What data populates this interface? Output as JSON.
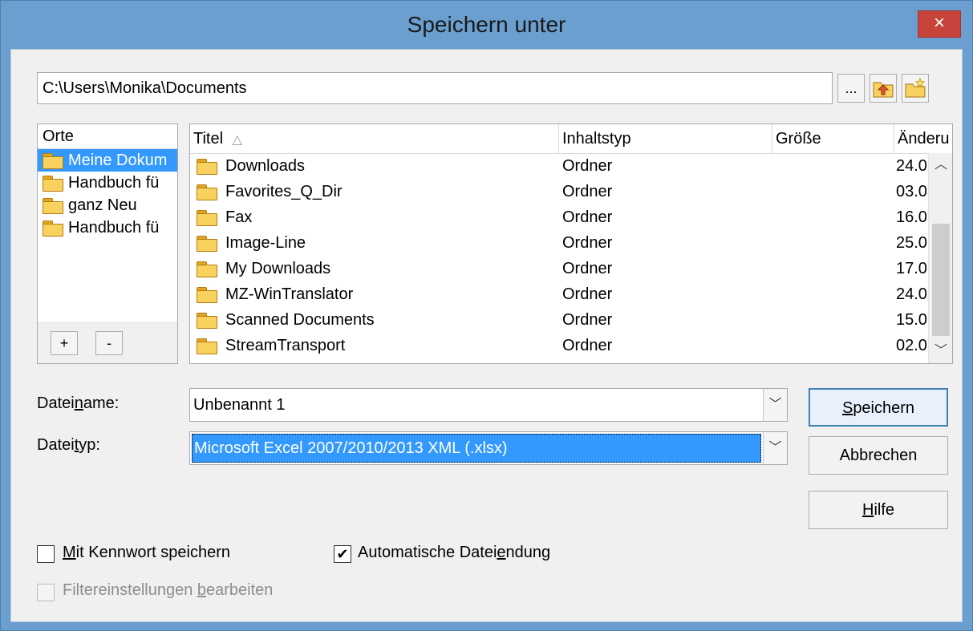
{
  "window": {
    "title": "Speichern unter",
    "close_icon": "×"
  },
  "path": {
    "value": "C:\\Users\\Monika\\Documents",
    "browse_label": "...",
    "up_icon": "folder-up-icon",
    "new_folder_icon": "new-folder-icon"
  },
  "places": {
    "header": "Orte",
    "items": [
      {
        "label": "Meine Dokum",
        "selected": true
      },
      {
        "label": "Handbuch fü",
        "selected": false
      },
      {
        "label": "ganz Neu",
        "selected": false
      },
      {
        "label": "Handbuch fü",
        "selected": false
      }
    ],
    "add_label": "+",
    "remove_label": "-"
  },
  "files": {
    "columns": [
      "Titel",
      "Inhaltstyp",
      "Größe",
      "Änderu"
    ],
    "sort_indicator": "△",
    "rows": [
      {
        "name": "Downloads",
        "type": "Ordner",
        "date": "24.0"
      },
      {
        "name": "Favorites_Q_Dir",
        "type": "Ordner",
        "date": "03.0"
      },
      {
        "name": "Fax",
        "type": "Ordner",
        "date": "16.0"
      },
      {
        "name": "Image-Line",
        "type": "Ordner",
        "date": "25.0"
      },
      {
        "name": "My Downloads",
        "type": "Ordner",
        "date": "17.0"
      },
      {
        "name": "MZ-WinTranslator",
        "type": "Ordner",
        "date": "24.0"
      },
      {
        "name": "Scanned Documents",
        "type": "Ordner",
        "date": "15.0"
      },
      {
        "name": "StreamTransport",
        "type": "Ordner",
        "date": "02.0"
      }
    ]
  },
  "form": {
    "filename_label_pre": "Datei",
    "filename_label_u": "n",
    "filename_label_post": "ame:",
    "filename_value": "Unbenannt 1",
    "filetype_label_pre": "Datei",
    "filetype_label_u": "t",
    "filetype_label_post": "yp:",
    "filetype_value": "Microsoft Excel 2007/2010/2013 XML (.xlsx)"
  },
  "buttons": {
    "save_u": "S",
    "save_rest": "peichern",
    "cancel": "Abbrechen",
    "help_u": "H",
    "help_rest": "ilfe"
  },
  "options": {
    "password_u": "M",
    "password_rest": "it Kennwort speichern",
    "password_checked": false,
    "autoext_pre": "Automatische Datei",
    "autoext_u": "e",
    "autoext_post": "ndung",
    "autoext_checked": true,
    "filter_pre": "Filtereinstellungen ",
    "filter_u": "b",
    "filter_post": "earbeiten",
    "filter_checked": false
  },
  "colors": {
    "title_bar": "#6a9fcf",
    "close_button": "#c8443a",
    "selection": "#3399ff",
    "folder": "#f8d15e"
  }
}
